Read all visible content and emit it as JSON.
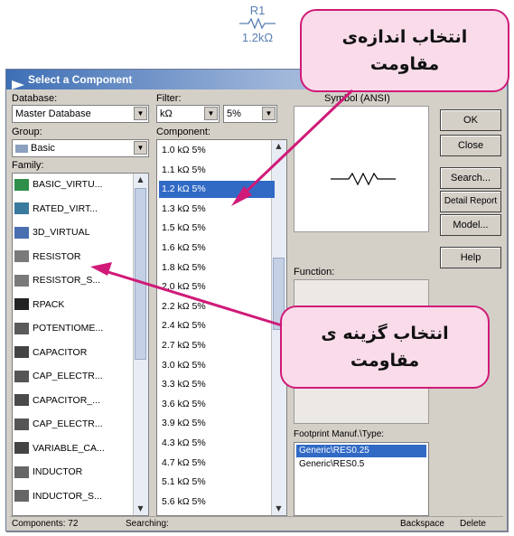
{
  "resistor_label": {
    "name": "R1",
    "value": "1.2kΩ"
  },
  "dialog": {
    "title": "Select a Component",
    "database_label": "Database:",
    "database_value": "Master Database",
    "group_label": "Group:",
    "group_value": "Basic",
    "family_label": "Family:",
    "filter_label": "Filter:",
    "filter_unit": "kΩ",
    "filter_tol": "5%",
    "component_label": "Component:",
    "symbol_label": "Symbol (ANSI)",
    "function_label": "Function:",
    "footprint_label": "Footprint Manuf.\\Type:",
    "family_items": [
      {
        "label": "BASIC_VIRTU...",
        "icon": "virtual-basic-icon"
      },
      {
        "label": "RATED_VIRT...",
        "icon": "virtual-rated-icon"
      },
      {
        "label": "3D_VIRTUAL",
        "icon": "virtual-3d-icon"
      },
      {
        "label": "RESISTOR",
        "icon": "resistor-icon"
      },
      {
        "label": "RESISTOR_S...",
        "icon": "resistor-smt-icon"
      },
      {
        "label": "RPACK",
        "icon": "rpack-icon"
      },
      {
        "label": "POTENTIOME...",
        "icon": "potentiometer-icon"
      },
      {
        "label": "CAPACITOR",
        "icon": "capacitor-icon"
      },
      {
        "label": "CAP_ELECTR...",
        "icon": "cap-electrolytic-icon"
      },
      {
        "label": "CAPACITOR_...",
        "icon": "capacitor-smt-icon"
      },
      {
        "label": "CAP_ELECTR...",
        "icon": "cap-electrolytic-smt-icon"
      },
      {
        "label": "VARIABLE_CA...",
        "icon": "variable-capacitor-icon"
      },
      {
        "label": "INDUCTOR",
        "icon": "inductor-icon"
      },
      {
        "label": "INDUCTOR_S...",
        "icon": "inductor-smt-icon"
      }
    ],
    "component_items": [
      "1.0 kΩ 5%",
      "1.1 kΩ 5%",
      "1.2 kΩ 5%",
      "1.3 kΩ 5%",
      "1.5 kΩ 5%",
      "1.6 kΩ 5%",
      "1.8 kΩ 5%",
      "2.0 kΩ 5%",
      "2.2 kΩ 5%",
      "2.4 kΩ 5%",
      "2.7 kΩ 5%",
      "3.0 kΩ 5%",
      "3.3 kΩ 5%",
      "3.6 kΩ 5%",
      "3.9 kΩ 5%",
      "4.3 kΩ 5%",
      "4.7 kΩ 5%",
      "5.1 kΩ 5%",
      "5.6 kΩ 5%"
    ],
    "selected_component_index": 2,
    "footprints": [
      "Generic\\RES0.25",
      "Generic\\RES0.5"
    ],
    "buttons": {
      "ok": "OK",
      "close": "Close",
      "search": "Search...",
      "detail": "Detail Report",
      "model": "Model...",
      "help": "Help"
    },
    "status": {
      "components": "Components: 72",
      "searching": "Searching:",
      "backspace": "Backspace",
      "delete": "Delete"
    }
  },
  "callouts": {
    "top": {
      "line1": "انتخاب اندازه‌ی",
      "line2": "مقاومت"
    },
    "bottom": {
      "line1": "انتخاب گزینه ی",
      "line2": "مقاومت"
    }
  },
  "colors": {
    "accent": "#d01a78",
    "callout_fill": "#f9dbea",
    "selection": "#316ac5",
    "dialog_bg": "#d4d0c8"
  }
}
